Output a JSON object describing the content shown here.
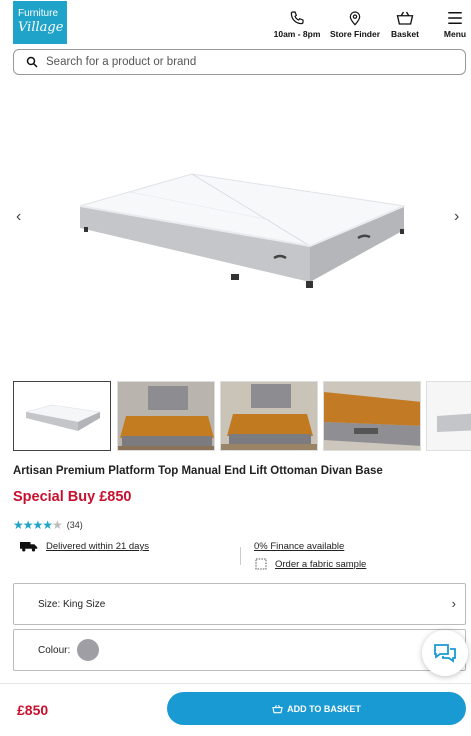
{
  "header": {
    "logo_line1": "Furniture",
    "logo_line2": "Village",
    "nav": {
      "phone_label": "10am - 8pm",
      "store_label": "Store Finder",
      "basket_label": "Basket",
      "menu_label": "Menu"
    }
  },
  "search": {
    "placeholder": "Search for a product or brand"
  },
  "gallery": {
    "prev_icon": "chevron-left-icon",
    "next_icon": "chevron-right-icon",
    "prev_glyph": "‹",
    "next_glyph": "›",
    "thumbnail_count_visible": 5
  },
  "product": {
    "title": "Artisan Premium Platform Top Manual End Lift Ottoman Divan Base",
    "price_label": "Special Buy £850",
    "rating": {
      "stars": 3.5,
      "count": "(34)"
    }
  },
  "info": {
    "delivery": "Delivered within 21 days",
    "finance": "0% Finance available",
    "sample": "Order a fabric sample"
  },
  "options": {
    "size_label": "Size: King Size",
    "colour_label": "Colour:",
    "colour_swatch": "#9e9ea4",
    "chevron": "›"
  },
  "bottom_bar": {
    "price": "£850",
    "add_to_basket": "ADD TO BASKET"
  },
  "colors": {
    "brand": "#1fa3c9",
    "button": "#1a9ad3",
    "price": "#c8102e"
  }
}
